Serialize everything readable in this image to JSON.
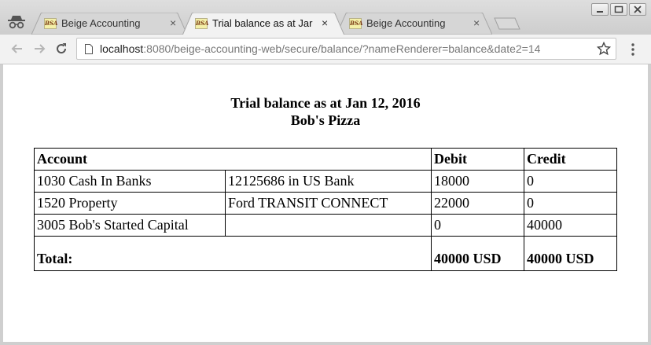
{
  "browser": {
    "tabs": [
      {
        "label": "Beige Accounting",
        "favicon": "BSA",
        "active": false
      },
      {
        "label": "Trial balance as at Jar",
        "favicon": "BSA",
        "active": true
      },
      {
        "label": "Beige Accounting",
        "favicon": "BSA",
        "active": false
      }
    ],
    "close_glyph": "×",
    "url_host": "localhost",
    "url_rest": ":8080/beige-accounting-web/secure/balance/?nameRenderer=balance&date2=14"
  },
  "page": {
    "title_line1": "Trial balance as at Jan 12, 2016",
    "title_line2": "Bob's Pizza"
  },
  "table": {
    "headers": {
      "account": "Account",
      "debit": "Debit",
      "credit": "Credit"
    },
    "rows": [
      {
        "account": "1030 Cash In Banks",
        "subaccount": "12125686 in US Bank",
        "debit": "18000",
        "credit": "0"
      },
      {
        "account": "1520 Property",
        "subaccount": "Ford TRANSIT CONNECT",
        "debit": "22000",
        "credit": "0"
      },
      {
        "account": "3005 Bob's Started Capital",
        "subaccount": "",
        "debit": "0",
        "credit": "40000"
      }
    ],
    "total": {
      "label": "Total:",
      "debit": "40000 USD",
      "credit": "40000 USD"
    }
  }
}
